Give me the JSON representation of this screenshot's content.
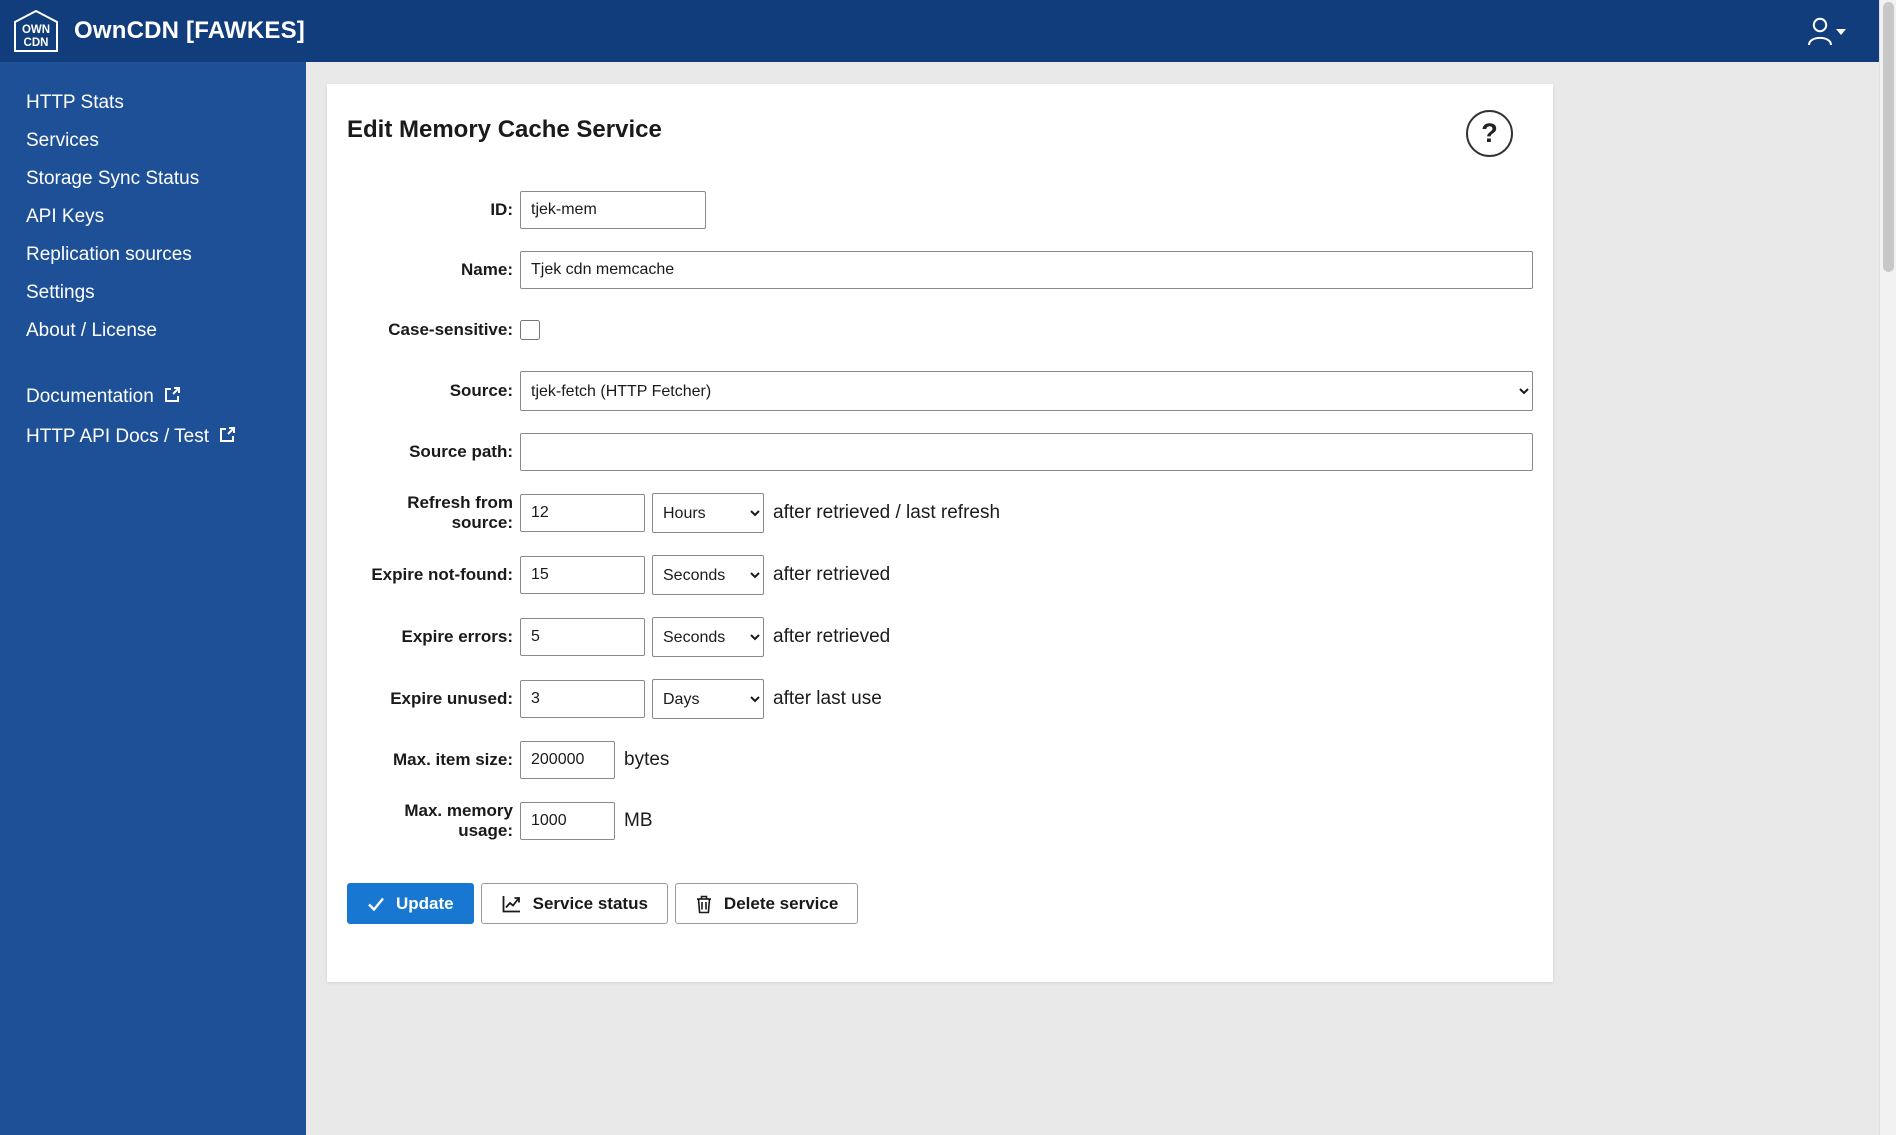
{
  "app": {
    "title": "OwnCDN [FAWKES]",
    "logo_line1": "OWN",
    "logo_line2": "CDN"
  },
  "sidebar": {
    "items": [
      "HTTP Stats",
      "Services",
      "Storage Sync Status",
      "API Keys",
      "Replication sources",
      "Settings",
      "About / License"
    ],
    "external_links": [
      "Documentation",
      "HTTP API Docs / Test"
    ]
  },
  "page": {
    "title": "Edit Memory Cache Service",
    "help_label": "?"
  },
  "form": {
    "id": {
      "label": "ID:",
      "value": "tjek-mem"
    },
    "name": {
      "label": "Name:",
      "value": "Tjek cdn memcache"
    },
    "case_sensitive": {
      "label": "Case-sensitive:"
    },
    "source": {
      "label": "Source:",
      "value": "tjek-fetch (HTTP Fetcher)"
    },
    "source_path": {
      "label": "Source path:",
      "value": ""
    },
    "refresh": {
      "label": "Refresh from source:",
      "value": "12",
      "unit": "Hours",
      "suffix": "after retrieved / last refresh"
    },
    "expire_not_found": {
      "label": "Expire not-found:",
      "value": "15",
      "unit": "Seconds",
      "suffix": "after retrieved"
    },
    "expire_errors": {
      "label": "Expire errors:",
      "value": "5",
      "unit": "Seconds",
      "suffix": "after retrieved"
    },
    "expire_unused": {
      "label": "Expire unused:",
      "value": "3",
      "unit": "Days",
      "suffix": "after last use"
    },
    "max_item_size": {
      "label": "Max. item size:",
      "value": "200000",
      "suffix": "bytes"
    },
    "max_memory": {
      "label": "Max. memory usage:",
      "value": "1000",
      "suffix": "MB"
    }
  },
  "buttons": {
    "update": "Update",
    "service_status": "Service status",
    "delete_service": "Delete service"
  }
}
